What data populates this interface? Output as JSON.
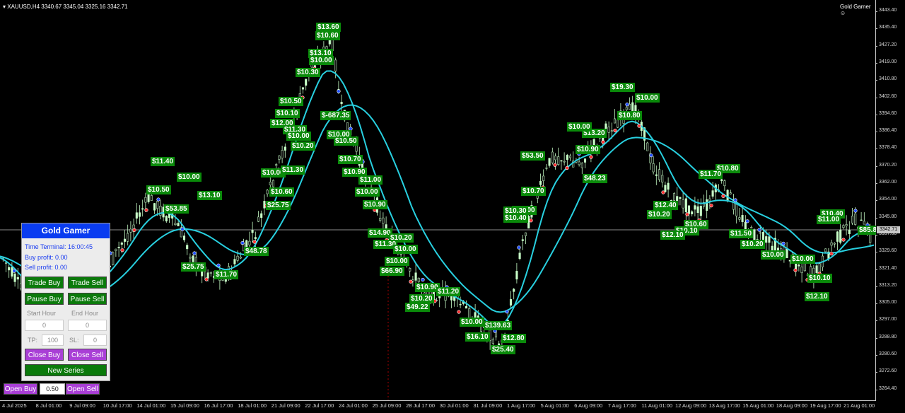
{
  "header": {
    "symbol_info": "XAUUSD,H4  3340.67 3345.04 3325.16 3342.71",
    "indicator_name": "Gold Gamer",
    "indicator_icon": "smiley-icon"
  },
  "price_axis": {
    "ticks": [
      "3443.40",
      "3435.40",
      "3427.20",
      "3419.00",
      "3410.80",
      "3402.60",
      "3394.60",
      "3386.40",
      "3378.40",
      "3370.20",
      "3362.00",
      "3354.00",
      "3345.80",
      "3337.60",
      "3329.60",
      "3321.40",
      "3313.20",
      "3305.00",
      "3297.00",
      "3288.80",
      "3280.60",
      "3272.60",
      "3264.40"
    ],
    "current_price": "3342.71"
  },
  "time_axis": {
    "ticks": [
      "4 Jul 2025",
      "8 Jul 01:00",
      "9 Jul 09:00",
      "10 Jul 17:00",
      "14 Jul 01:00",
      "15 Jul 09:00",
      "16 Jul 17:00",
      "18 Jul 01:00",
      "21 Jul 09:00",
      "22 Jul 17:00",
      "24 Jul 01:00",
      "25 Jul 09:00",
      "28 Jul 17:00",
      "30 Jul 01:00",
      "31 Jul 09:00",
      "1 Aug 17:00",
      "5 Aug 01:00",
      "6 Aug 09:00",
      "7 Aug 17:00",
      "11 Aug 01:00",
      "12 Aug 09:00",
      "13 Aug 17:00",
      "15 Aug 01:00",
      "18 Aug 09:00",
      "19 Aug 17:00",
      "21 Aug 01:00"
    ]
  },
  "profit_labels": [
    "$13.60",
    "$10.60",
    "$13.10",
    "$10.00",
    "$10.30",
    "$10.50",
    "$10.10",
    "$12.00",
    "$11.30",
    "$10.00",
    "$10.20",
    "$-687.35",
    "$10.00",
    "$10.50",
    "$10.70",
    "$10.90",
    "$11.00",
    "$10.00",
    "$10.90",
    "$14.90",
    "$10.20",
    "$11.30",
    "$10.00",
    "$10.00",
    "$66.90",
    "$10.90",
    "$11.20",
    "$10.20",
    "$49.22",
    "$10.00",
    "$139.63",
    "$16.10",
    "$12.80",
    "$25.40",
    "$11.40",
    "$10.00",
    "$10.50",
    "$53.85",
    "$13.10",
    "$25.75",
    "$10.60",
    "$25.75",
    "$10.00",
    "$11.70",
    "$48.78",
    "$10.00",
    "$11.30",
    "$10.00",
    "$53.50",
    "$10.70",
    "$10.30",
    "$10.40",
    "$19.30",
    "$10.00",
    "$10.80",
    "$13.20",
    "$10.90",
    "$10.00",
    "$48.23",
    "$10.80",
    "$11.70",
    "$12.40",
    "$10.20",
    "$10.60",
    "$10.10",
    "$12.10",
    "$11.50",
    "$10.20",
    "$10.00",
    "$10.00",
    "$10.40",
    "$11.00",
    "$85.84",
    "$10.10",
    "$12.10"
  ],
  "panel": {
    "title": "Gold Gamer",
    "time_terminal": "Time Terminal: 16:00:45",
    "buy_profit": "Buy profit: 0.00",
    "sell_profit": "Sell profit: 0.00",
    "trade_buy": "Trade Buy",
    "trade_sell": "Trade Sell",
    "pause_buy": "Pause Buy",
    "pause_sell": "Pause Sell",
    "start_hour_label": "Start Hour",
    "end_hour_label": "End Hour",
    "start_hour_value": "0",
    "end_hour_value": "0",
    "tp_label": "TP:",
    "tp_value": "100",
    "sl_label": "SL:",
    "sl_value": "0",
    "close_buy": "Close Buy",
    "close_sell": "Close Sell",
    "new_series": "New Series"
  },
  "bottom_bar": {
    "open_buy": "Open Buy",
    "lot_value": "0.50",
    "open_sell": "Open Sell"
  },
  "colors": {
    "background": "#000000",
    "bull_candle": "#c8ffc8",
    "ma_line": "#28d0e0",
    "profit_label": "#0a8a0a",
    "panel_title": "#0a3cf0",
    "button_green": "#0b7a0b",
    "button_purple": "#a93fd6",
    "buy_marker": "#2050ff",
    "sell_marker": "#ff3030"
  }
}
